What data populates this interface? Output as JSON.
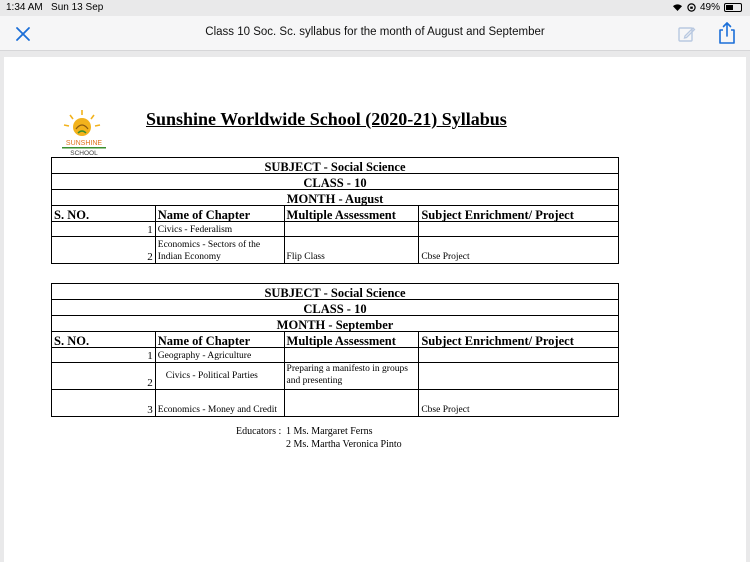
{
  "status": {
    "time": "1:34 AM",
    "date": "Sun 13 Sep",
    "battery": "49%",
    "battery_level": 0.49
  },
  "nav": {
    "title": "Class 10 Soc. Sc. syllabus for the month of August and September"
  },
  "doc": {
    "logo_text_top": "SUNSHINE",
    "logo_text_bottom": "SCHOOL",
    "title": "Sunshine Worldwide School (2020-21) Syllabus",
    "columns": [
      "S. NO.",
      "Name of Chapter",
      "Multiple Assessment",
      "Subject Enrichment/ Project"
    ],
    "august": {
      "subject": "SUBJECT - Social Science",
      "class": "CLASS - 10",
      "month": "MONTH - August",
      "rows": [
        {
          "no": "1",
          "chapter": "Civics - Federalism",
          "assessment": "",
          "project": ""
        },
        {
          "no": "2",
          "chapter": "Economics - Sectors of the Indian Economy",
          "assessment": "Flip Class",
          "project": "Cbse Project"
        }
      ]
    },
    "september": {
      "subject": "SUBJECT - Social Science",
      "class": "CLASS - 10",
      "month": "MONTH - September",
      "rows": [
        {
          "no": "1",
          "chapter": "Geography - Agriculture",
          "assessment": "",
          "project": ""
        },
        {
          "no": "2",
          "chapter": "Civics - Political Parties",
          "assessment": "Preparing a manifesto in groups and presenting",
          "project": ""
        },
        {
          "no": "3",
          "chapter": "Economics - Money and Credit",
          "assessment": "",
          "project": "Cbse Project"
        }
      ]
    },
    "educators": {
      "label": "Educators :",
      "list": [
        "1 Ms. Margaret Ferns",
        "2 Ms. Martha Veronica Pinto"
      ]
    }
  }
}
